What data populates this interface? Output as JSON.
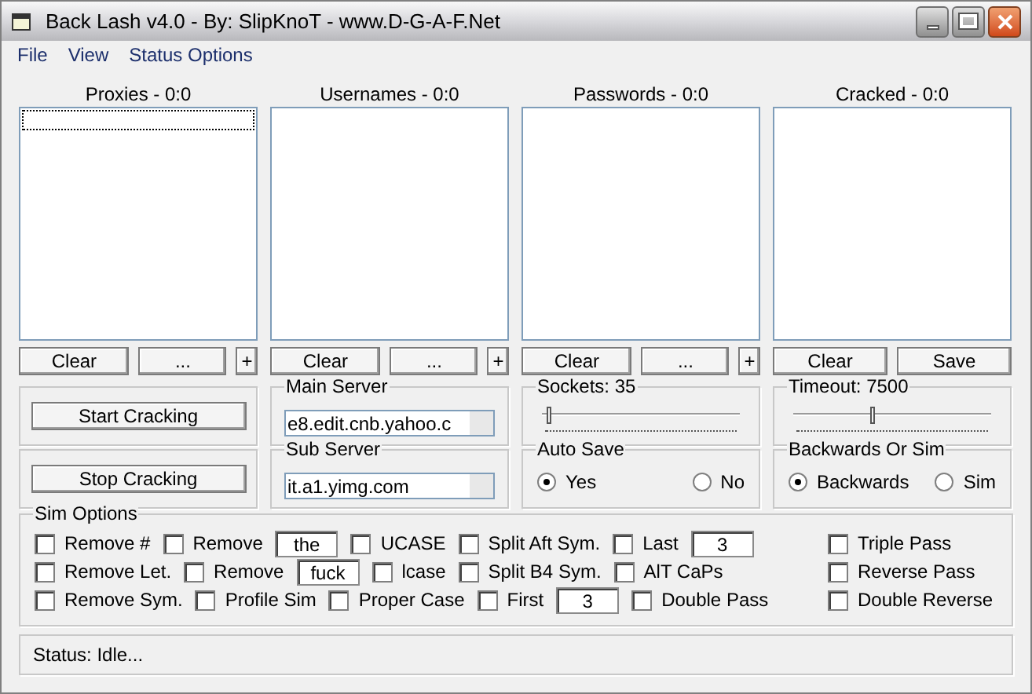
{
  "window": {
    "title": "Back Lash v4.0 - By: SlipKnoT - www.D-G-A-F.Net"
  },
  "menu": [
    "File",
    "View",
    "Status Options"
  ],
  "lists": [
    {
      "title": "Proxies - 0:0",
      "focused": true,
      "buttons": [
        {
          "kind": "wide",
          "label": "Clear"
        },
        {
          "kind": "wide",
          "label": "..."
        },
        {
          "kind": "small",
          "label": "+"
        }
      ]
    },
    {
      "title": "Usernames - 0:0",
      "focused": false,
      "buttons": [
        {
          "kind": "wide",
          "label": "Clear"
        },
        {
          "kind": "wide",
          "label": "..."
        },
        {
          "kind": "small",
          "label": "+"
        }
      ]
    },
    {
      "title": "Passwords - 0:0",
      "focused": false,
      "buttons": [
        {
          "kind": "wide",
          "label": "Clear"
        },
        {
          "kind": "wide",
          "label": "..."
        },
        {
          "kind": "small",
          "label": "+"
        }
      ]
    },
    {
      "title": "Cracked - 0:0",
      "focused": false,
      "buttons": [
        {
          "kind": "half",
          "label": "Clear"
        },
        {
          "kind": "half",
          "label": "Save"
        }
      ]
    }
  ],
  "actions": [
    "Start Cracking",
    "Stop Cracking"
  ],
  "servers": [
    {
      "label": "Main Server",
      "value": "e8.edit.cnb.yahoo.c"
    },
    {
      "label": "Sub Server",
      "value": "it.a1.yimg.com"
    }
  ],
  "sliders": [
    {
      "label": "Sockets: 35",
      "level": 0.03
    },
    {
      "label": "Timeout: 7500",
      "level": 0.4
    }
  ],
  "radio_groups": [
    {
      "label": "Auto Save",
      "options": [
        {
          "label": "Yes",
          "selected": true
        },
        {
          "label": "No",
          "selected": false
        }
      ]
    },
    {
      "label": "Backwards Or Sim",
      "options": [
        {
          "label": "Backwards",
          "selected": true
        },
        {
          "label": "Sim",
          "selected": false
        }
      ]
    }
  ],
  "sim_options": {
    "title": "Sim Options",
    "rows": [
      {
        "items": [
          {
            "kind": "checkbox",
            "label": "Remove #",
            "checked": false
          },
          {
            "kind": "checkbox",
            "label": "Remove",
            "checked": false
          },
          {
            "kind": "field",
            "value": "the"
          },
          {
            "kind": "checkbox",
            "label": "UCASE",
            "checked": false
          },
          {
            "kind": "checkbox",
            "label": "Split Aft Sym.",
            "checked": false
          },
          {
            "kind": "checkbox",
            "label": "Last",
            "checked": false
          },
          {
            "kind": "field",
            "value": "3"
          }
        ],
        "right": {
          "label": "Triple Pass",
          "checked": false
        }
      },
      {
        "items": [
          {
            "kind": "checkbox",
            "label": "Remove Let.",
            "checked": false
          },
          {
            "kind": "checkbox",
            "label": "Remove",
            "checked": false
          },
          {
            "kind": "field",
            "value": "fuck"
          },
          {
            "kind": "checkbox",
            "label": "lcase",
            "checked": false
          },
          {
            "kind": "checkbox",
            "label": "Split B4 Sym.",
            "checked": false
          },
          {
            "kind": "checkbox",
            "label": "AlT CaPs",
            "checked": false
          }
        ],
        "right": {
          "label": "Reverse Pass",
          "checked": false
        }
      },
      {
        "items": [
          {
            "kind": "checkbox",
            "label": "Remove Sym.",
            "checked": false
          },
          {
            "kind": "checkbox",
            "label": "Profile Sim",
            "checked": false
          },
          {
            "kind": "checkbox",
            "label": "Proper Case",
            "checked": false
          },
          {
            "kind": "checkbox",
            "label": "First",
            "checked": false
          },
          {
            "kind": "field",
            "value": "3"
          },
          {
            "kind": "checkbox",
            "label": "Double Pass",
            "checked": false
          }
        ],
        "right": {
          "label": "Double Reverse",
          "checked": false
        }
      }
    ]
  },
  "status_bar": "Status: Idle..."
}
